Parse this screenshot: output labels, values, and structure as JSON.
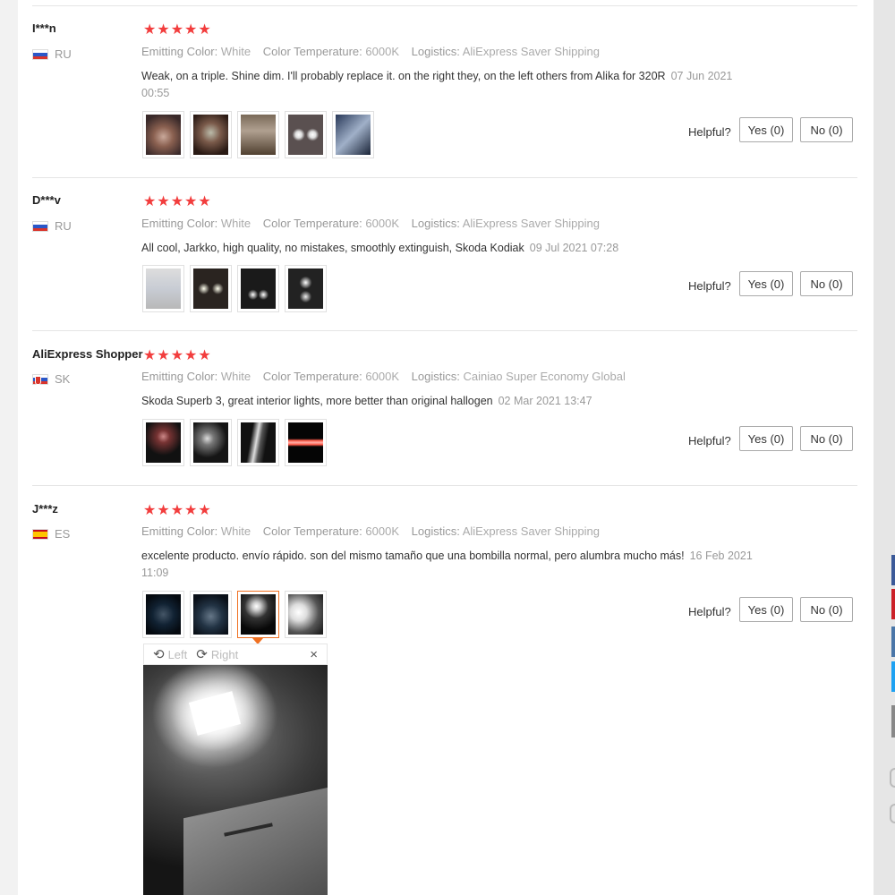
{
  "labels": {
    "emitting_color_key": "Emitting Color:",
    "color_temperature_key": "Color Temperature:",
    "logistics_key": "Logistics:",
    "helpful": "Helpful?"
  },
  "reviews": [
    {
      "user": "I***n",
      "country": "RU",
      "stars": "★★★★★",
      "rating": 5,
      "emitting_color": "White",
      "color_temperature": "6000K",
      "logistics": "AliExpress Saver Shipping",
      "text": "Weak, on a triple. Shine dim. I'll probably replace it. on the right they, on the left others from Alika for 320R",
      "date": "07 Jun 2021 00:55",
      "yes_label": "Yes (0)",
      "no_label": "No (0)"
    },
    {
      "user": "D***v",
      "country": "RU",
      "stars": "★★★★★",
      "rating": 5,
      "emitting_color": "White",
      "color_temperature": "6000K",
      "logistics": "AliExpress Saver Shipping",
      "text": "All cool, Jarkko, high quality, no mistakes, smoothly extinguish, Skoda Kodiak",
      "date": "09 Jul 2021 07:28",
      "yes_label": "Yes (0)",
      "no_label": "No (0)"
    },
    {
      "user": "AliExpress Shopper",
      "country": "SK",
      "stars": "★★★★★",
      "rating": 5,
      "emitting_color": "White",
      "color_temperature": "6000K",
      "logistics": "Cainiao Super Economy Global",
      "text": "Skoda Superb 3, great interior lights, more better than original hallogen",
      "date": "02 Mar 2021 13:47",
      "yes_label": "Yes (0)",
      "no_label": "No (0)"
    },
    {
      "user": "J***z",
      "country": "ES",
      "stars": "★★★★★",
      "rating": 5,
      "emitting_color": "White",
      "color_temperature": "6000K",
      "logistics": "AliExpress Saver Shipping",
      "text": "excelente producto. envío rápido. son del mismo tamaño que una bombilla normal, pero alumbra mucho más!",
      "date": "16 Feb 2021 11:09",
      "yes_label": "Yes (0)",
      "no_label": "No (0)"
    }
  ],
  "viewer": {
    "rotate_left_label": "Left",
    "rotate_right_label": "Right",
    "close_glyph": "×"
  },
  "colors": {
    "star": "#f23d3d",
    "selected_thumb": "#f07020",
    "share_facebook": "#3b5998",
    "share_pinterest": "#cb2027",
    "share_vk": "#4a76a8",
    "share_twitter": "#1da1f2",
    "share_other": "#888888"
  }
}
